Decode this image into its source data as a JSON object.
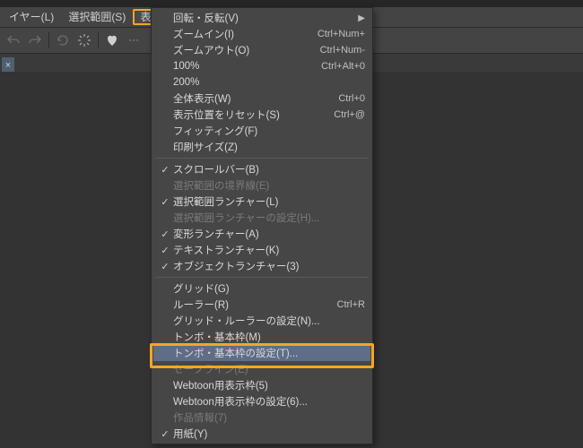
{
  "titlebar": "",
  "menubar": {
    "items": [
      "イヤー(L)",
      "選択範囲(S)",
      "表示(V)"
    ],
    "active_index": 2
  },
  "tab": {
    "close_glyph": "×"
  },
  "dropdown": {
    "rows": [
      {
        "label": "回転・反転(V)",
        "sub": "▶"
      },
      {
        "label": "ズームイン(I)",
        "accel": "Ctrl+Num+"
      },
      {
        "label": "ズームアウト(O)",
        "accel": "Ctrl+Num-"
      },
      {
        "label": "100%",
        "accel": "Ctrl+Alt+0"
      },
      {
        "label": "200%"
      },
      {
        "label": "全体表示(W)",
        "accel": "Ctrl+0"
      },
      {
        "label": "表示位置をリセット(S)",
        "accel": "Ctrl+@"
      },
      {
        "label": "フィッティング(F)"
      },
      {
        "label": "印刷サイズ(Z)"
      },
      {
        "sep": true
      },
      {
        "label": "スクロールバー(B)",
        "checked": true
      },
      {
        "label": "選択範囲の境界線(E)",
        "disabled": true
      },
      {
        "label": "選択範囲ランチャー(L)",
        "checked": true
      },
      {
        "label": "選択範囲ランチャーの設定(H)...",
        "disabled": true
      },
      {
        "label": "変形ランチャー(A)",
        "checked": true
      },
      {
        "label": "テキストランチャー(K)",
        "checked": true
      },
      {
        "label": "オブジェクトランチャー(3)",
        "checked": true
      },
      {
        "sep": true
      },
      {
        "label": "グリッド(G)"
      },
      {
        "label": "ルーラー(R)",
        "accel": "Ctrl+R"
      },
      {
        "label": "グリッド・ルーラーの設定(N)..."
      },
      {
        "label": "トンボ・基本枠(M)"
      },
      {
        "label": "トンボ・基本枠の設定(T)...",
        "highlighted": true
      },
      {
        "label": "セーフライン(E)",
        "disabled": true
      },
      {
        "label": "Webtoon用表示枠(5)"
      },
      {
        "label": "Webtoon用表示枠の設定(6)..."
      },
      {
        "label": "作品情報(7)",
        "disabled": true
      },
      {
        "label": "用紙(Y)",
        "checked": true
      }
    ]
  }
}
